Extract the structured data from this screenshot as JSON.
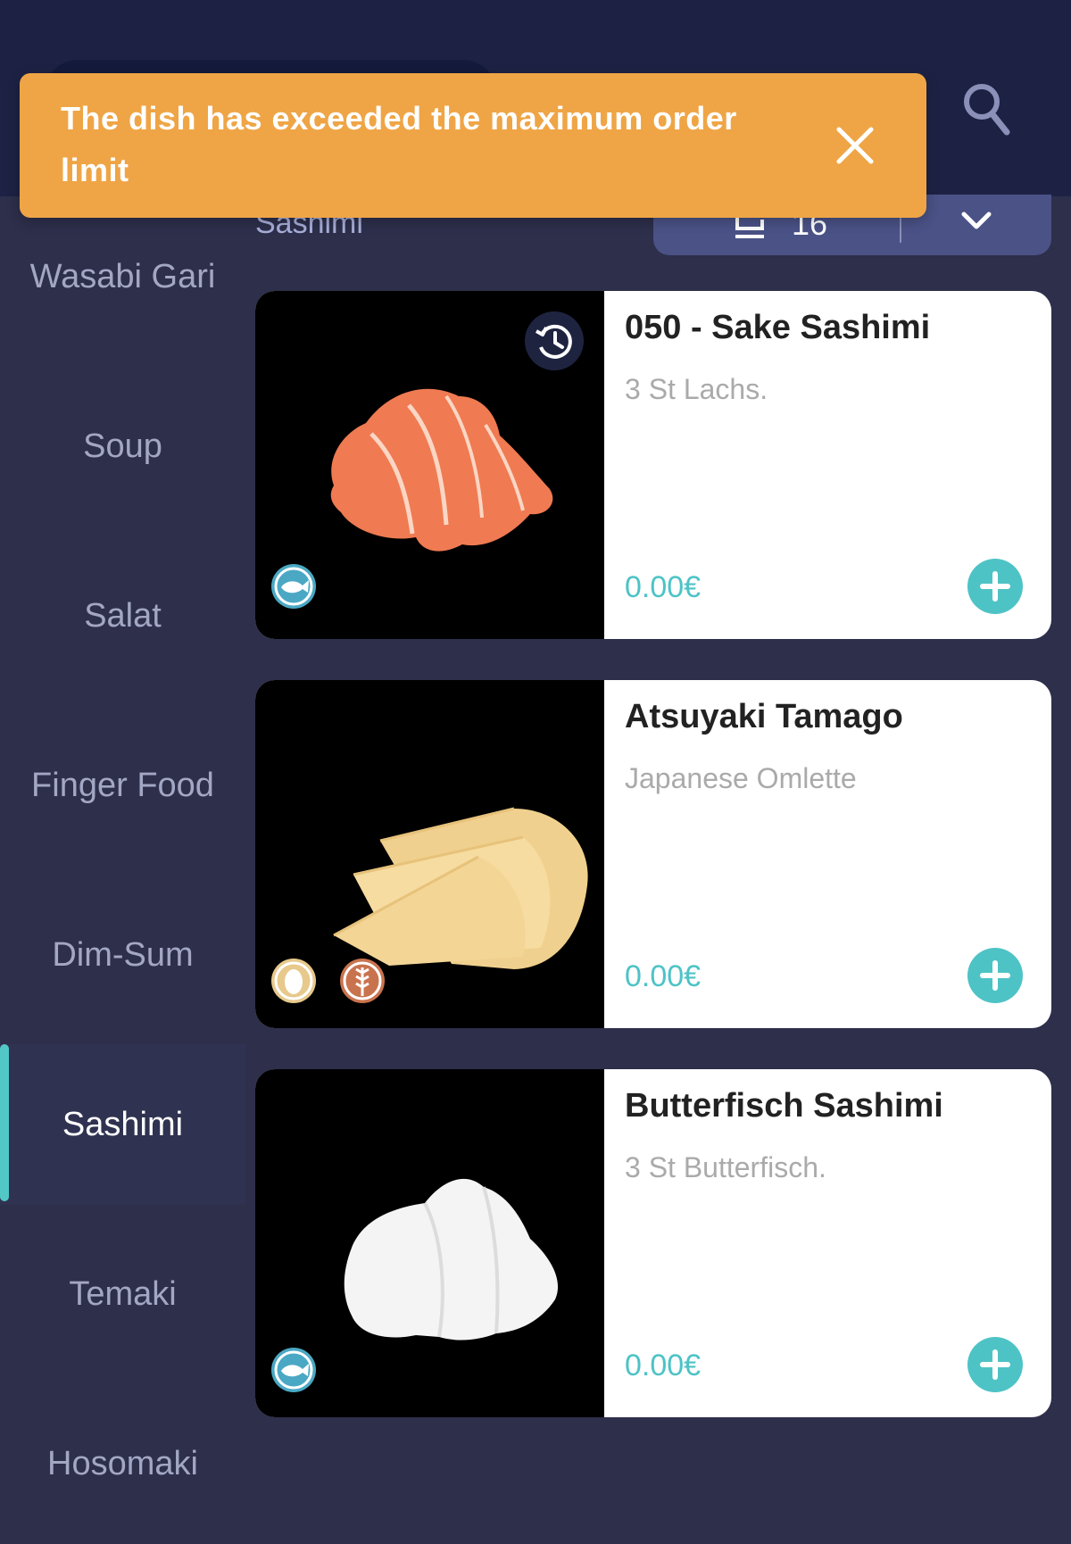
{
  "header": {
    "section_label": "Sashimi",
    "table_number": "16"
  },
  "toast": {
    "message": "The dish has exceeded the maximum order limit"
  },
  "sidebar": {
    "items": [
      {
        "label": "Wasabi Gari"
      },
      {
        "label": "Soup"
      },
      {
        "label": "Salat"
      },
      {
        "label": "Finger Food"
      },
      {
        "label": "Dim-Sum"
      },
      {
        "label": "Sashimi",
        "active": true
      },
      {
        "label": "Temaki"
      },
      {
        "label": "Hosomaki"
      }
    ]
  },
  "dishes": [
    {
      "name": "050 - Sake Sashimi",
      "description": "3 St Lachs.",
      "price": "0.00€",
      "badges": [
        "fish-icon"
      ],
      "history": true
    },
    {
      "name": "Atsuyaki Tamago",
      "description": "Japanese Omlette",
      "price": "0.00€",
      "badges": [
        "egg-icon",
        "wheat-icon"
      ]
    },
    {
      "name": "Butterfisch Sashimi",
      "description": "3 St Butterfisch.",
      "price": "0.00€",
      "badges": [
        "fish-icon"
      ]
    }
  ],
  "colors": {
    "background": "#2d2f4b",
    "topbar": "#1d2244",
    "toast": "#efa546",
    "accent": "#4ec3c6",
    "table_select": "#4a5286"
  }
}
